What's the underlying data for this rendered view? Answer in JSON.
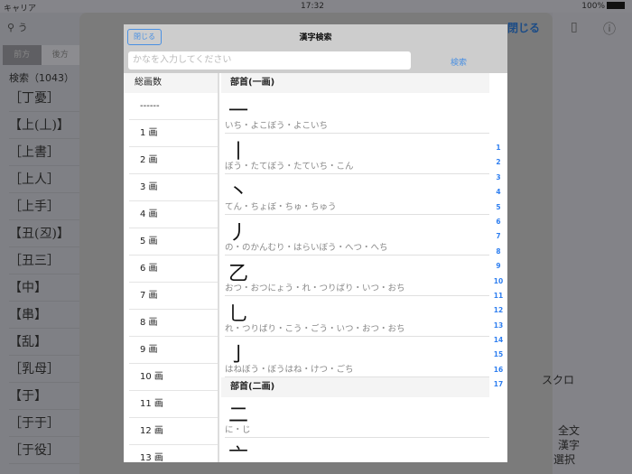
{
  "status": {
    "carrier": "キャリア",
    "time": "17:32",
    "battery": "100%"
  },
  "background": {
    "search_value": "う",
    "segments": [
      "前方",
      "後方"
    ],
    "count_label": "検索（1043）",
    "list": [
      "［丁憂］",
      "【上(丄)】",
      "［上書］",
      "［上人］",
      "［上手］",
      "【丑(丒)】",
      "［丑三］",
      "【中】",
      "【串】",
      "【乱】",
      "［乳母］",
      "【于】",
      "［于于］",
      "［于役］"
    ],
    "sheet_close": "閉じる",
    "right_texts": [
      "スクロ",
      "全文",
      "漢字",
      "選択"
    ]
  },
  "modal": {
    "close_label": "閉じる",
    "title": "漢字検索",
    "input_placeholder": "かなを入力してください",
    "search_label": "検索",
    "stroke_header": "総画数",
    "strokes": [
      "------",
      "1 画",
      "2 画",
      "3 画",
      "4 画",
      "5 画",
      "6 画",
      "7 画",
      "8 画",
      "9 画",
      "10 画",
      "11 画",
      "12 画",
      "13 画"
    ],
    "sections": [
      {
        "header": "部首(一画)",
        "items": [
          {
            "kanji": "一",
            "reading": "いち・よこぼう・よこいち"
          },
          {
            "kanji": "丨",
            "reading": "ぼう・たてぼう・たていち・こん"
          },
          {
            "kanji": "丶",
            "reading": "てん・ちょぼ・ちゅ・ちゅう"
          },
          {
            "kanji": "丿",
            "reading": "の・のかんむり・はらいぼう・へつ・へち"
          },
          {
            "kanji": "乙",
            "reading": "おつ・おつにょう・れ・つりばり・いつ・おち"
          },
          {
            "kanji": "乚",
            "reading": "れ・つりばり・こう・ごう・いつ・おつ・おち"
          },
          {
            "kanji": "亅",
            "reading": "はねぼう・ぼうはね・けつ・ごち"
          }
        ]
      },
      {
        "header": "部首(二画)",
        "items": [
          {
            "kanji": "二",
            "reading": "に・じ"
          },
          {
            "kanji": "亠",
            "reading": ""
          }
        ]
      }
    ],
    "index": [
      "1",
      "2",
      "3",
      "4",
      "5",
      "6",
      "7",
      "8",
      "9",
      "10",
      "11",
      "12",
      "13",
      "14",
      "15",
      "16",
      "17"
    ]
  }
}
